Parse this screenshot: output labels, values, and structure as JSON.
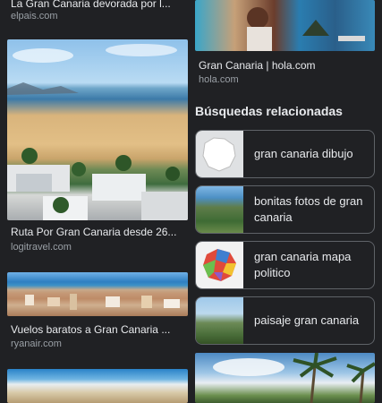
{
  "left_column": {
    "results": [
      {
        "title": "La Gran Canaria devorada por l...",
        "source": "elpais.com"
      },
      {
        "title": "Ruta Por Gran Canaria desde 26...",
        "source": "logitravel.com"
      },
      {
        "title": "Vuelos baratos a Gran Canaria ...",
        "source": "ryanair.com"
      }
    ]
  },
  "right_column": {
    "results": [
      {
        "title": "Gran Canaria | hola.com",
        "source": "hola.com"
      }
    ],
    "related": {
      "heading": "Búsquedas relacionadas",
      "items": [
        {
          "label": "gran canaria dibujo"
        },
        {
          "label": "bonitas fotos de gran canaria"
        },
        {
          "label": "gran canaria mapa politico"
        },
        {
          "label": "paisaje gran canaria"
        }
      ]
    }
  }
}
